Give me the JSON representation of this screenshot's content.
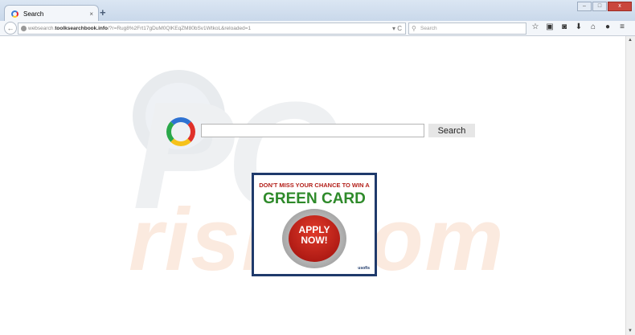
{
  "browser": {
    "tab": {
      "title": "Search",
      "close": "×"
    },
    "new_tab": "+",
    "window_buttons": {
      "minimize": "–",
      "maximize": "□",
      "close": "x"
    },
    "back": "←",
    "url": {
      "prefix": "websearch.",
      "domain": "toolksearchbook.info",
      "path": "/?r=Rug8%2Frt17gDuM0QlKEqZM80bSv1WtkoL&reloaded=1",
      "reload": "▾ C"
    },
    "search_placeholder": "Search",
    "toolbar_icons": [
      "☆",
      "▣",
      "◙",
      "⬇",
      "⌂",
      "●",
      "≡"
    ]
  },
  "page": {
    "watermark": {
      "top": "PC",
      "bottom": "risk.com"
    },
    "search_button": "Search",
    "search_value": "",
    "ad": {
      "line1": "DON'T MISS YOUR CHANCE TO WIN A",
      "line2": "GREEN CARD",
      "button_line1": "APPLY",
      "button_line2": "NOW!",
      "brand": "usofis"
    }
  }
}
